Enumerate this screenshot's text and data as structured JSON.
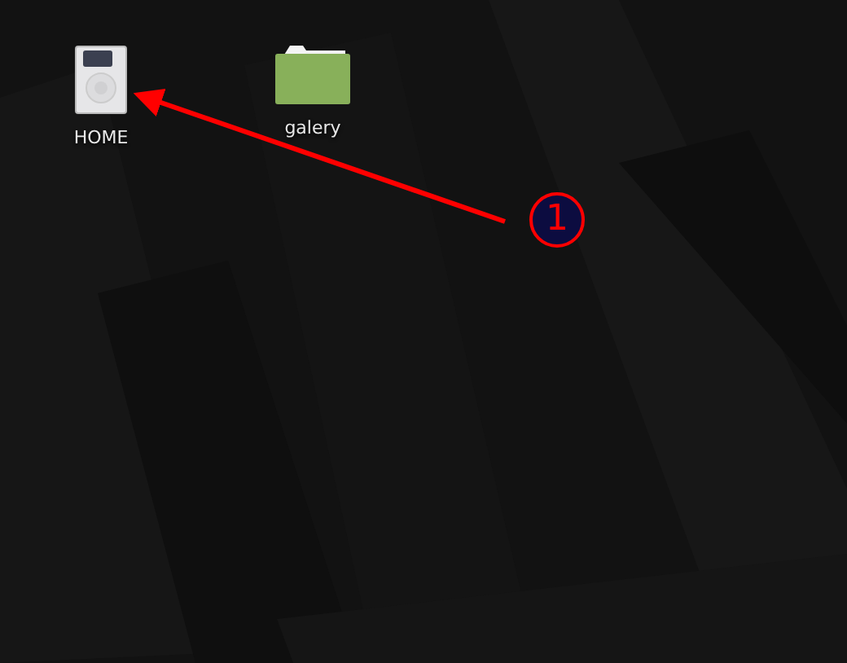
{
  "desktop_icons": [
    {
      "kind": "drive",
      "label": "HOME"
    },
    {
      "kind": "folder",
      "label": "galery"
    }
  ],
  "annotation": {
    "label": "1"
  }
}
